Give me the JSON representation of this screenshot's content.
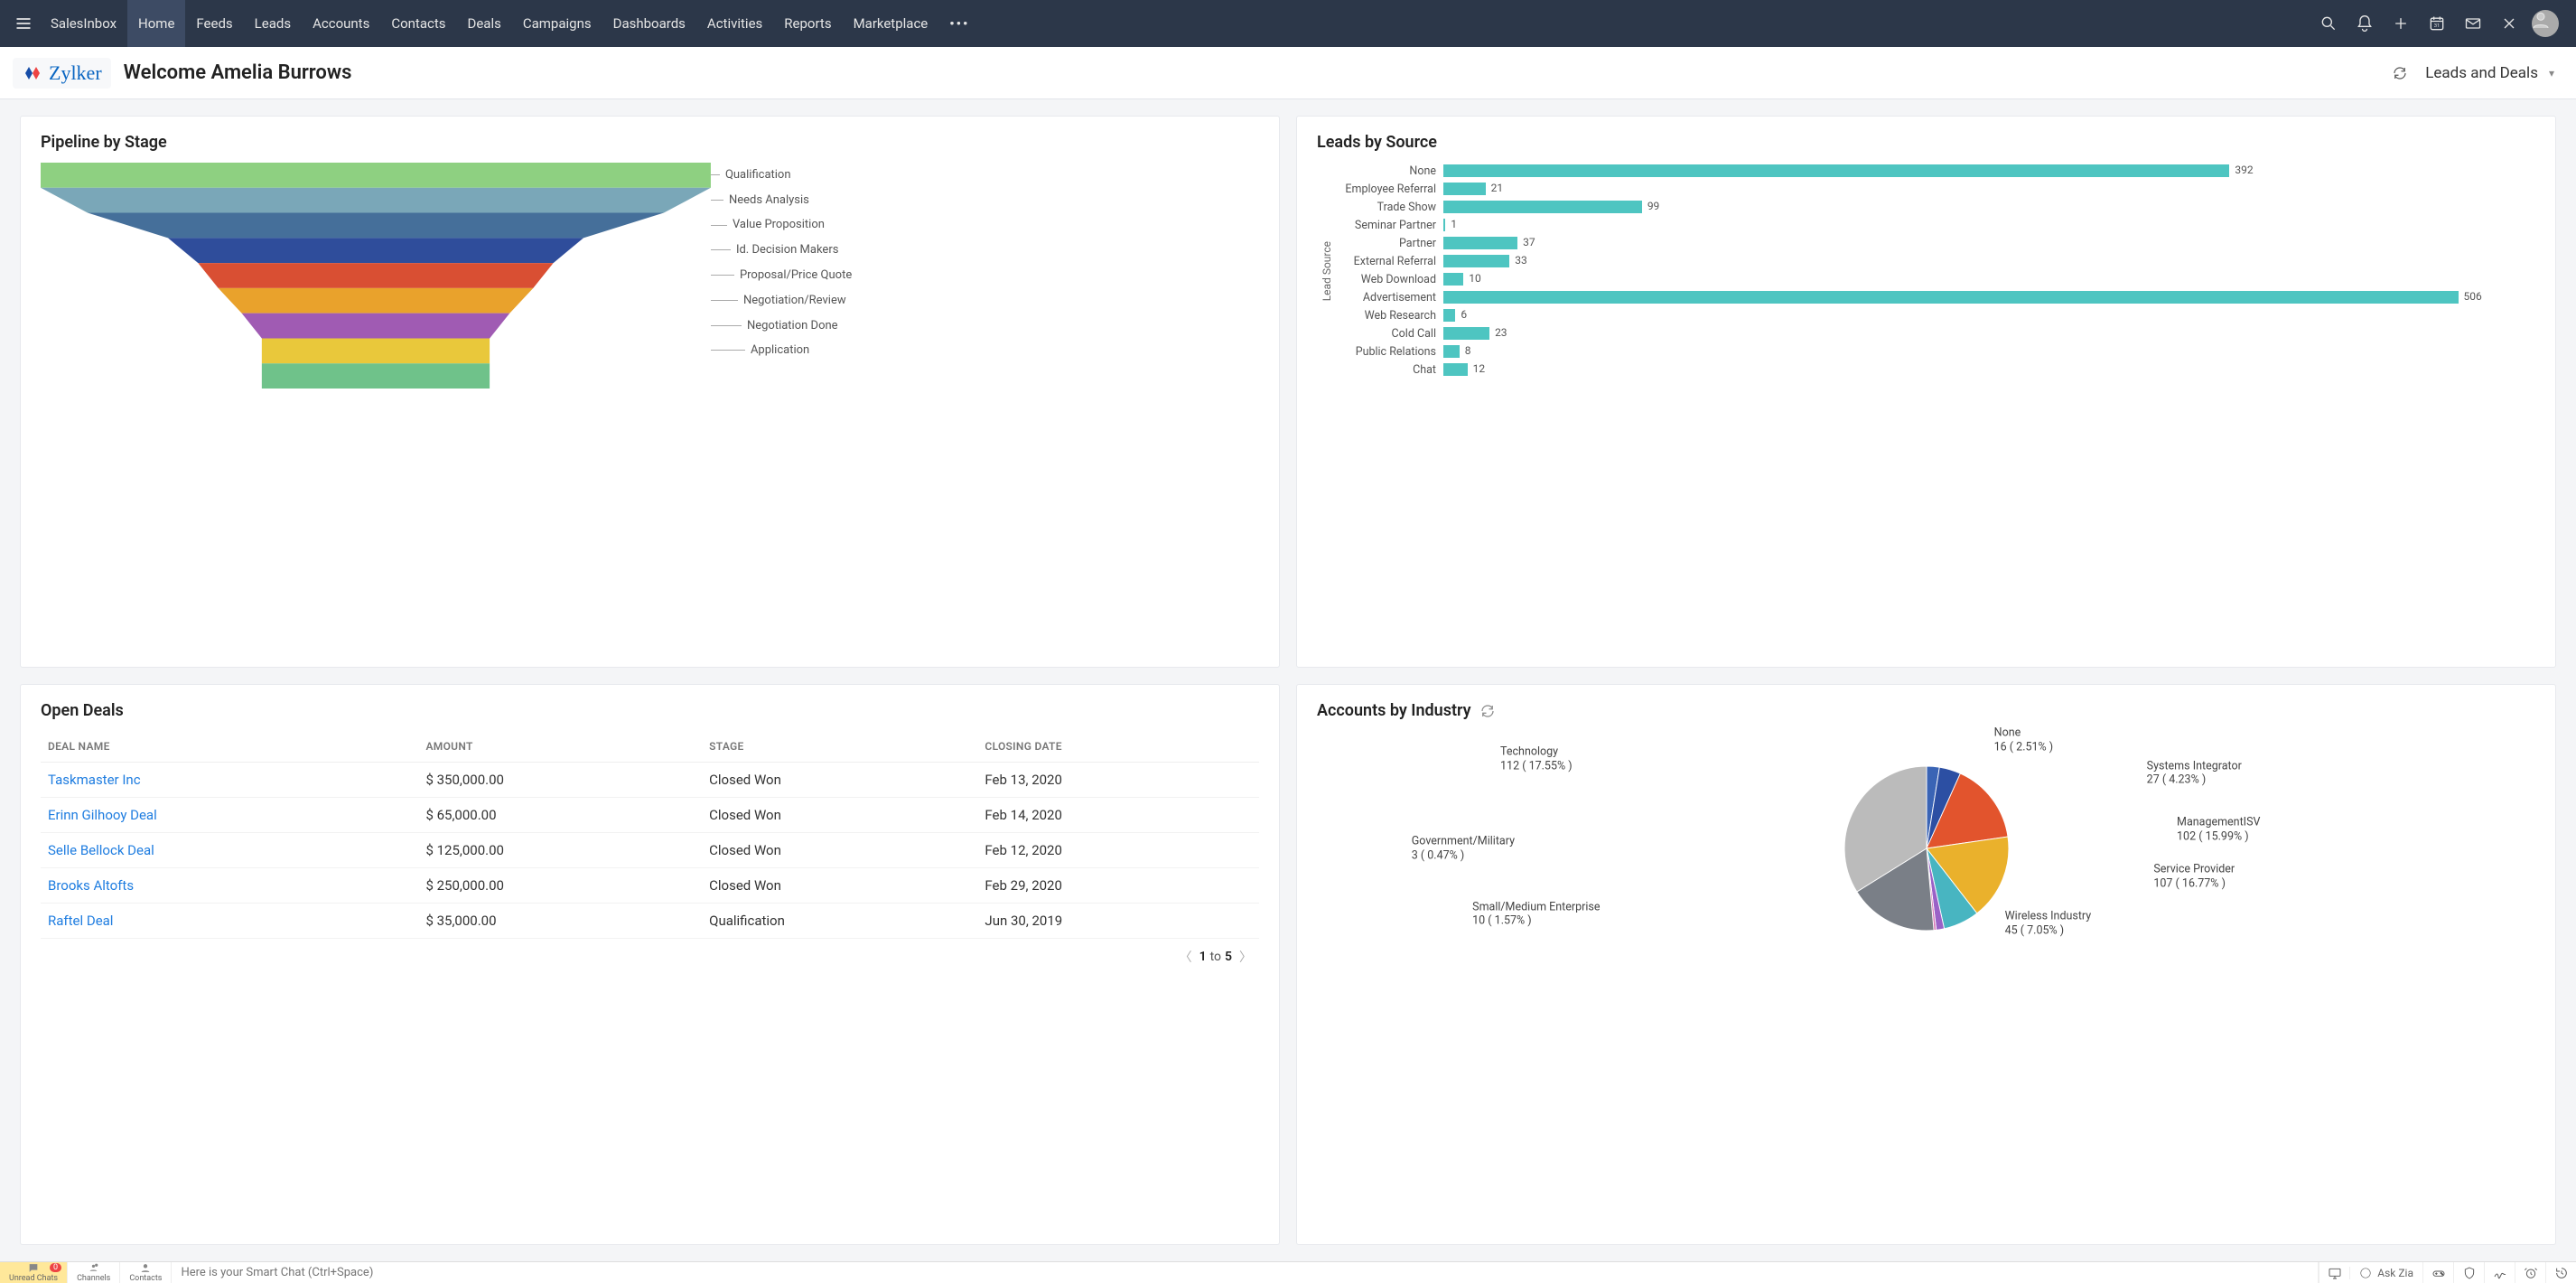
{
  "topnav": {
    "items": [
      "SalesInbox",
      "Home",
      "Feeds",
      "Leads",
      "Accounts",
      "Contacts",
      "Deals",
      "Campaigns",
      "Dashboards",
      "Activities",
      "Reports",
      "Marketplace"
    ],
    "active_index": 1
  },
  "subheader": {
    "brand": "Zylker",
    "welcome": "Welcome Amelia Burrows",
    "view": "Leads and Deals"
  },
  "cards": {
    "pipeline": {
      "title": "Pipeline by Stage"
    },
    "leads_by_source": {
      "title": "Leads by Source"
    },
    "open_deals": {
      "title": "Open Deals"
    },
    "accounts_by_industry": {
      "title": "Accounts by Industry"
    }
  },
  "chart_data": [
    {
      "id": "pipeline",
      "type": "funnel",
      "title": "Pipeline by Stage",
      "stages": [
        {
          "label": "Qualification",
          "color": "#8ed081",
          "width": 1.0
        },
        {
          "label": "Needs Analysis",
          "color": "#7aa7b8",
          "width": 0.86
        },
        {
          "label": "Value Proposition",
          "color": "#456f9a",
          "width": 0.62
        },
        {
          "label": "Id. Decision Makers",
          "color": "#2f4d9b",
          "width": 0.53
        },
        {
          "label": "Proposal/Price Quote",
          "color": "#d94f33",
          "width": 0.47
        },
        {
          "label": "Negotiation/Review",
          "color": "#e9a22c",
          "width": 0.4
        },
        {
          "label": "Negotiation Done",
          "color": "#a05bb3",
          "width": 0.34
        },
        {
          "label": "Application",
          "color": "#e9c83b",
          "width": 0.34
        },
        {
          "label": "",
          "color": "#6fc28a",
          "width": 0.34
        }
      ]
    },
    {
      "id": "leads_by_source",
      "type": "bar",
      "orientation": "horizontal",
      "title": "Leads by Source",
      "ylabel": "Lead Source",
      "max": 540,
      "categories": [
        "None",
        "Employee Referral",
        "Trade Show",
        "Seminar Partner",
        "Partner",
        "External Referral",
        "Web Download",
        "Advertisement",
        "Web Research",
        "Cold Call",
        "Public Relations",
        "Chat"
      ],
      "values": [
        392,
        21,
        99,
        1,
        37,
        33,
        10,
        506,
        6,
        23,
        8,
        12
      ]
    },
    {
      "id": "accounts_by_industry",
      "type": "pie",
      "title": "Accounts by Industry",
      "series": [
        {
          "name": "None",
          "value": 16,
          "pct": "2.51%",
          "color": "#3a64b5"
        },
        {
          "name": "Systems Integrator",
          "value": 27,
          "pct": "4.23%",
          "color": "#2c4fa3"
        },
        {
          "name": "ManagementISV",
          "value": 102,
          "pct": "15.99%",
          "color": "#e2542d"
        },
        {
          "name": "Service Provider",
          "value": 107,
          "pct": "16.77%",
          "color": "#eab12c"
        },
        {
          "name": "Wireless Industry",
          "value": 45,
          "pct": "7.05%",
          "color": "#48b5c1"
        },
        {
          "name": "Small/Medium Enterprise",
          "value": 10,
          "pct": "1.57%",
          "color": "#9a62c7"
        },
        {
          "name": "Government/Military",
          "value": 3,
          "pct": "0.47%",
          "color": "#d774b5"
        },
        {
          "name": "Technology",
          "value": 112,
          "pct": "17.55%",
          "color": "#7a7f87"
        }
      ],
      "other_pct": 33.86
    }
  ],
  "open_deals": {
    "columns": [
      "DEAL NAME",
      "AMOUNT",
      "STAGE",
      "CLOSING DATE"
    ],
    "rows": [
      {
        "name": "Taskmaster Inc",
        "amount": "$ 350,000.00",
        "stage": "Closed Won",
        "closing": "Feb 13, 2020"
      },
      {
        "name": "Erinn Gilhooy Deal",
        "amount": "$ 65,000.00",
        "stage": "Closed Won",
        "closing": "Feb 14, 2020"
      },
      {
        "name": "Selle Bellock Deal",
        "amount": "$ 125,000.00",
        "stage": "Closed Won",
        "closing": "Feb 12, 2020"
      },
      {
        "name": "Brooks Altofts",
        "amount": "$ 250,000.00",
        "stage": "Closed Won",
        "closing": "Feb 29, 2020"
      },
      {
        "name": "Raftel Deal",
        "amount": "$ 35,000.00",
        "stage": "Qualification",
        "closing": "Jun 30, 2019"
      }
    ],
    "pager": {
      "current": "1",
      "sep": "to",
      "total": "5"
    }
  },
  "bottombar": {
    "items": [
      {
        "label": "Unread Chats",
        "badge": "0"
      },
      {
        "label": "Channels"
      },
      {
        "label": "Contacts"
      }
    ],
    "placeholder": "Here is your Smart Chat (Ctrl+Space)",
    "askzia": "Ask Zia"
  }
}
